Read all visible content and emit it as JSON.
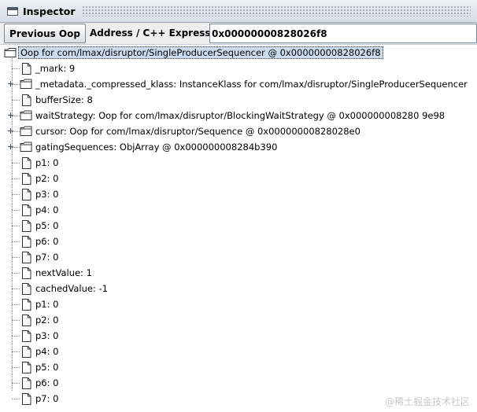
{
  "window": {
    "title": "Inspector"
  },
  "toolbar": {
    "previous_oop_label": "Previous Oop",
    "address_label": "Address / C++ Expression:",
    "address_value": "0x00000000828026f8"
  },
  "tree": {
    "root_label": "Oop for com/lmax/disruptor/SingleProducerSequencer @ 0x00000000828026f8",
    "fields": [
      {
        "label": "_mark: 9",
        "type": "leaf"
      },
      {
        "label": "_metadata._compressed_klass: InstanceKlass for com/lmax/disruptor/SingleProducerSequencer",
        "type": "folder"
      },
      {
        "label": "bufferSize: 8",
        "type": "leaf"
      },
      {
        "label": "waitStrategy: Oop for com/lmax/disruptor/BlockingWaitStrategy @ 0x000000008280 9e98",
        "type": "folder"
      },
      {
        "label": "cursor: Oop for com/lmax/disruptor/Sequence @ 0x00000000828028e0",
        "type": "folder"
      },
      {
        "label": "gatingSequences: ObjArray @ 0x000000008284b390",
        "type": "folder"
      },
      {
        "label": "p1: 0",
        "type": "leaf"
      },
      {
        "label": "p2: 0",
        "type": "leaf"
      },
      {
        "label": "p3: 0",
        "type": "leaf"
      },
      {
        "label": "p4: 0",
        "type": "leaf"
      },
      {
        "label": "p5: 0",
        "type": "leaf"
      },
      {
        "label": "p6: 0",
        "type": "leaf"
      },
      {
        "label": "p7: 0",
        "type": "leaf"
      },
      {
        "label": "nextValue: 1",
        "type": "leaf"
      },
      {
        "label": "cachedValue: -1",
        "type": "leaf"
      },
      {
        "label": "p1: 0",
        "type": "leaf"
      },
      {
        "label": "p2: 0",
        "type": "leaf"
      },
      {
        "label": "p3: 0",
        "type": "leaf"
      },
      {
        "label": "p4: 0",
        "type": "leaf"
      },
      {
        "label": "p5: 0",
        "type": "leaf"
      },
      {
        "label": "p6: 0",
        "type": "leaf"
      },
      {
        "label": "p7: 0",
        "type": "leaf"
      }
    ]
  },
  "watermark": "@稀土掘金技术社区"
}
